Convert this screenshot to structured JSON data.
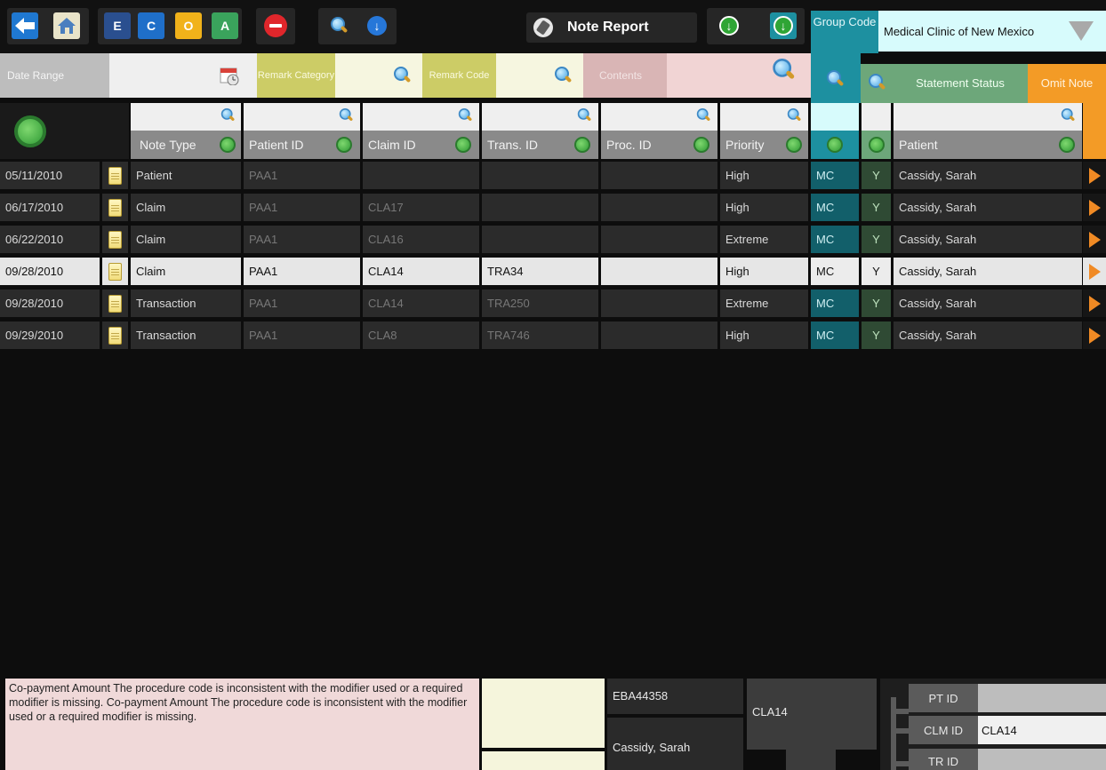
{
  "colors": {
    "teal": "#1d90a0",
    "light_cyan": "#d7fbfc",
    "remark_yellow": "#cccc66",
    "contents_pink": "#d9b5b5",
    "status_green": "#6da77a",
    "omit_orange": "#f39b26",
    "selected_row": "#e6e6e6",
    "note_bg": "#f0d9d9"
  },
  "toolbar": {
    "letters": [
      "E",
      "C",
      "O",
      "A"
    ],
    "icons": [
      "back-arrow-icon",
      "home-icon",
      "stop-icon",
      "search-icon",
      "download-icon",
      "note-report-icon",
      "green-down-arrow-icon",
      "teal-down-arrow-icon",
      "filter-funnel-icon"
    ],
    "title": "Note Report",
    "group_code_label": "Group Code",
    "clinic": "Medical Clinic of New Mexico"
  },
  "filters": {
    "date_range": "Date Range",
    "remark_category": "Remark Category",
    "remark_code": "Remark Code",
    "contents": "Contents",
    "statement_status": "Statement Status",
    "omit_note": "Omit Note"
  },
  "columns": {
    "note_type": "Note Type",
    "patient_id": "Patient ID",
    "claim_id": "Claim ID",
    "trans_id": "Trans. ID",
    "proc_id": "Proc. ID",
    "priority": "Priority",
    "patient": "Patient"
  },
  "rows": [
    {
      "date": "05/11/2010",
      "note_type": "Patient",
      "patient_id": "PAA1",
      "claim_id": "",
      "trans_id": "",
      "proc_id": "",
      "priority": "High",
      "group": "MC",
      "status": "Y",
      "patient": "Cassidy, Sarah"
    },
    {
      "date": "06/17/2010",
      "note_type": "Claim",
      "patient_id": "PAA1",
      "claim_id": "CLA17",
      "trans_id": "",
      "proc_id": "",
      "priority": "High",
      "group": "MC",
      "status": "Y",
      "patient": "Cassidy, Sarah"
    },
    {
      "date": "06/22/2010",
      "note_type": "Claim",
      "patient_id": "PAA1",
      "claim_id": "CLA16",
      "trans_id": "",
      "proc_id": "",
      "priority": "Extreme",
      "group": "MC",
      "status": "Y",
      "patient": "Cassidy, Sarah"
    },
    {
      "date": "09/28/2010",
      "note_type": "Claim",
      "patient_id": "PAA1",
      "claim_id": "CLA14",
      "trans_id": "TRA34",
      "proc_id": "",
      "priority": "High",
      "group": "MC",
      "status": "Y",
      "patient": "Cassidy, Sarah",
      "selected": true
    },
    {
      "date": "09/28/2010",
      "note_type": "Transaction",
      "patient_id": "PAA1",
      "claim_id": "CLA14",
      "trans_id": "TRA250",
      "proc_id": "",
      "priority": "Extreme",
      "group": "MC",
      "status": "Y",
      "patient": "Cassidy, Sarah"
    },
    {
      "date": "09/29/2010",
      "note_type": "Transaction",
      "patient_id": "PAA1",
      "claim_id": "CLA8",
      "trans_id": "TRA746",
      "proc_id": "",
      "priority": "High",
      "group": "MC",
      "status": "Y",
      "patient": "Cassidy, Sarah"
    }
  ],
  "bottom": {
    "note_text": "Co-payment Amount The procedure code is inconsistent with the modifier used or a required modifier is missing. Co-payment Amount The procedure code is inconsistent with the modifier used or a required modifier is missing.",
    "code": "EBA44358",
    "patient": "Cassidy, Sarah",
    "claim": "CLA14",
    "pt_id_label": "PT ID",
    "pt_id_value": "",
    "clm_id_label": "CLM ID",
    "clm_id_value": "CLA14",
    "tr_id_label": "TR ID",
    "tr_id_value": ""
  }
}
